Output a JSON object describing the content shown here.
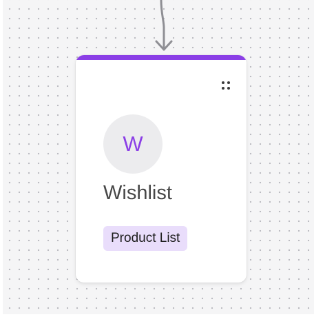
{
  "node": {
    "avatar_letter": "W",
    "title": "Wishlist",
    "tag": "Product List",
    "accent_color": "#8b3fe6",
    "tag_background": "#e9ddfb"
  },
  "icons": {
    "connector": "arrow-down-icon",
    "drag_handle": "drag-handle-icon"
  }
}
